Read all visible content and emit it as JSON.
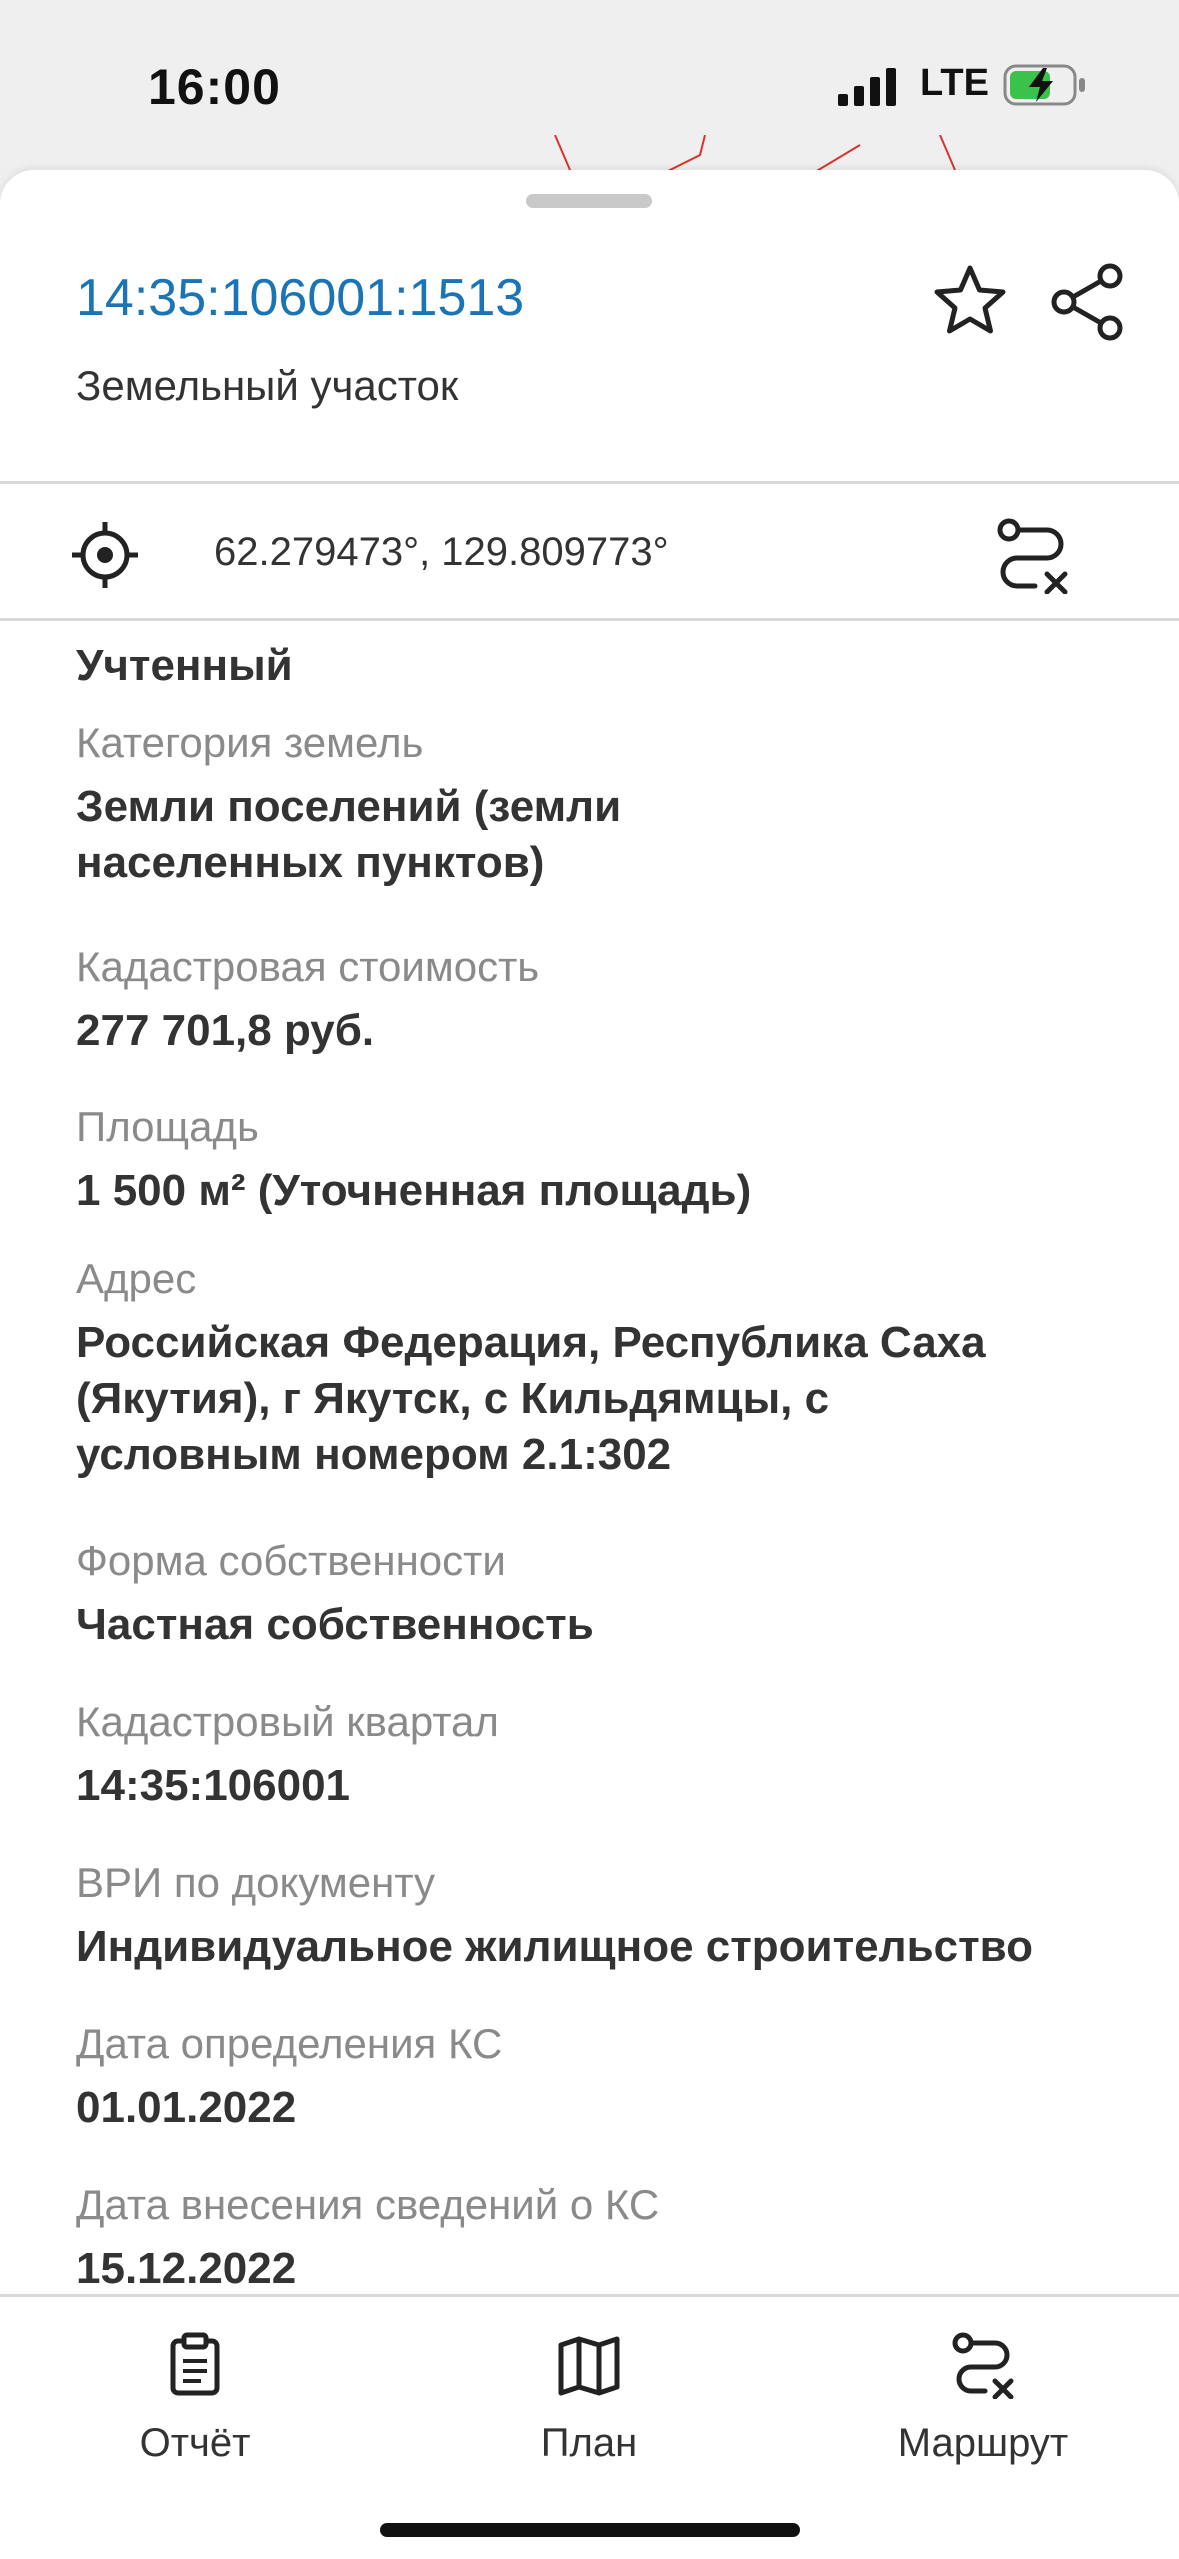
{
  "status_bar": {
    "time": "16:00",
    "network": "LTE"
  },
  "header": {
    "cadastral_number": "14:35:106001:1513",
    "object_type": "Земельный участок"
  },
  "location": {
    "coordinates": "62.279473°, 129.809773°"
  },
  "details": {
    "status": "Учтенный",
    "fields": [
      {
        "label": "Категория земель",
        "value_lines": [
          "Земли поселений (земли",
          "населенных пунктов)"
        ]
      },
      {
        "label": "Кадастровая стоимость",
        "value_lines": [
          "277 701,8 руб."
        ]
      },
      {
        "label": "Площадь",
        "value_lines": [
          "1 500 м² (Уточненная площадь)"
        ]
      },
      {
        "label": "Адрес",
        "value_lines": [
          "Российская Федерация, Республика Саха",
          "(Якутия), г Якутск, с Кильдямцы, с",
          "условным номером 2.1:302"
        ]
      },
      {
        "label": "Форма собственности",
        "value_lines": [
          "Частная собственность"
        ]
      },
      {
        "label": "Кадастровый квартал",
        "value_lines": [
          "14:35:106001"
        ]
      },
      {
        "label": "ВРИ по документу",
        "value_lines": [
          "Индивидуальное жилищное строительство"
        ]
      },
      {
        "label": "Дата определения КС",
        "value_lines": [
          "01.01.2022"
        ]
      },
      {
        "label": "Дата внесения сведений о КС",
        "value_lines": [
          "15.12.2022"
        ]
      }
    ]
  },
  "tabbar": {
    "report": "Отчёт",
    "plan": "План",
    "route": "Маршрут"
  },
  "colors": {
    "accent": "#1b74b5",
    "text": "#333333",
    "label": "#8a8a8a",
    "map_line": "#d9342b"
  }
}
